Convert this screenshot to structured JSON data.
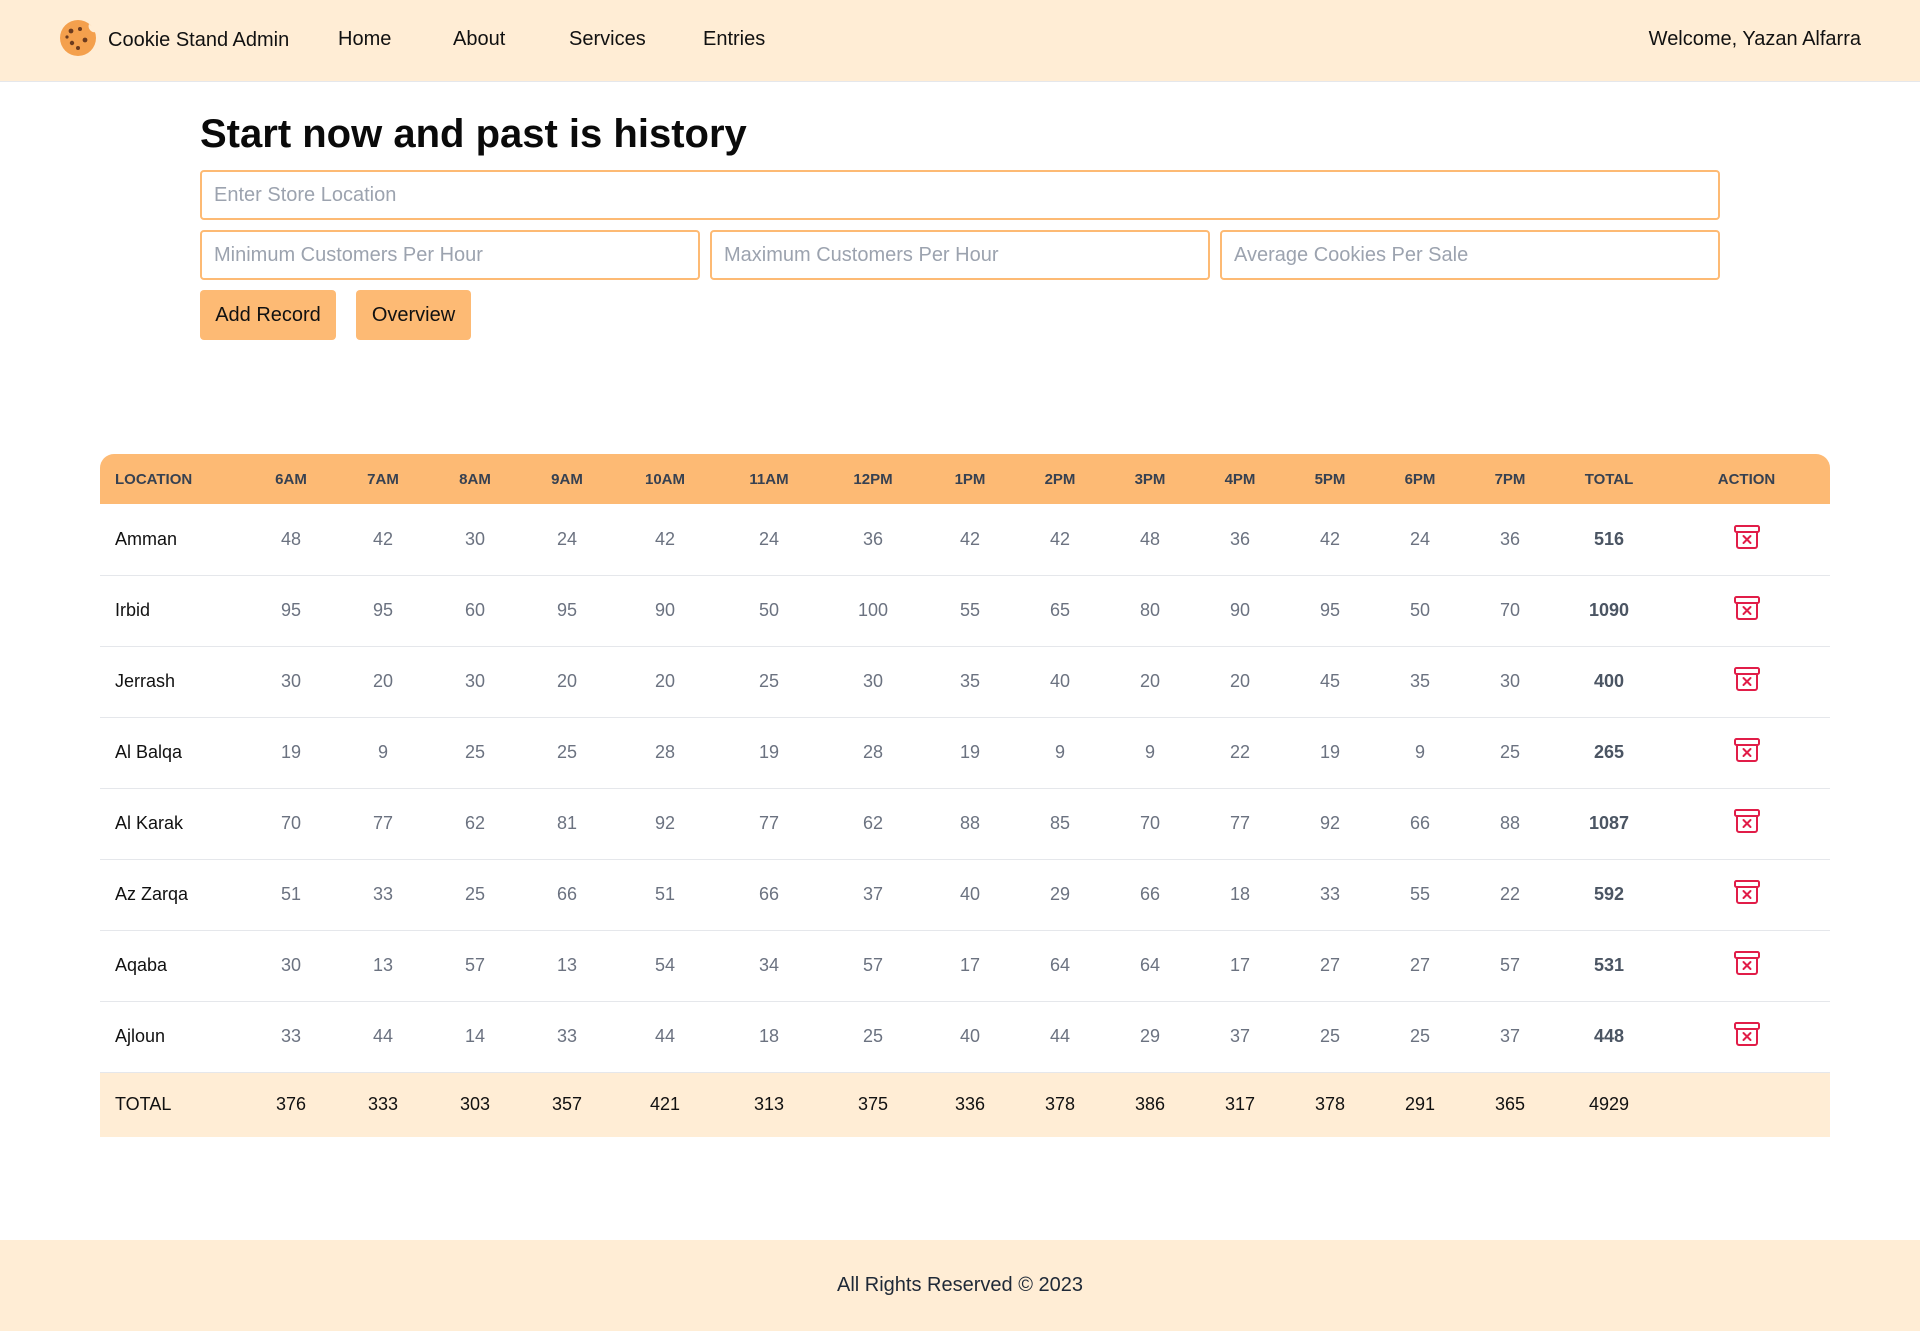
{
  "header": {
    "brand": "Cookie Stand Admin",
    "brand_icon": "cookie-icon",
    "nav": [
      {
        "label": "Home"
      },
      {
        "label": "About"
      },
      {
        "label": "Services"
      },
      {
        "label": "Entries"
      }
    ],
    "welcome": "Welcome, Yazan Alfarra"
  },
  "form": {
    "title": "Start now and past is history",
    "location_placeholder": "Enter Store Location",
    "min_placeholder": "Minimum Customers Per Hour",
    "max_placeholder": "Maximum Customers Per Hour",
    "avg_placeholder": "Average Cookies Per Sale",
    "add_label": "Add Record",
    "overview_label": "Overview"
  },
  "table": {
    "headers": [
      "LOCATION",
      "6AM",
      "7AM",
      "8AM",
      "9AM",
      "10AM",
      "11AM",
      "12PM",
      "1PM",
      "2PM",
      "3PM",
      "4PM",
      "5PM",
      "6PM",
      "7PM",
      "TOTAL",
      "ACTION"
    ],
    "action_icon": "trash-x-icon",
    "rows": [
      {
        "location": "Amman",
        "hours": [
          48,
          42,
          30,
          24,
          42,
          24,
          36,
          42,
          42,
          48,
          36,
          42,
          24,
          36
        ],
        "total": 516
      },
      {
        "location": "Irbid",
        "hours": [
          95,
          95,
          60,
          95,
          90,
          50,
          100,
          55,
          65,
          80,
          90,
          95,
          50,
          70
        ],
        "total": 1090
      },
      {
        "location": "Jerrash",
        "hours": [
          30,
          20,
          30,
          20,
          20,
          25,
          30,
          35,
          40,
          20,
          20,
          45,
          35,
          30
        ],
        "total": 400
      },
      {
        "location": "Al Balqa",
        "hours": [
          19,
          9,
          25,
          25,
          28,
          19,
          28,
          19,
          9,
          9,
          22,
          19,
          9,
          25
        ],
        "total": 265
      },
      {
        "location": "Al Karak",
        "hours": [
          70,
          77,
          62,
          81,
          92,
          77,
          62,
          88,
          85,
          70,
          77,
          92,
          66,
          88
        ],
        "total": 1087
      },
      {
        "location": "Az Zarqa",
        "hours": [
          51,
          33,
          25,
          66,
          51,
          66,
          37,
          40,
          29,
          66,
          18,
          33,
          55,
          22
        ],
        "total": 592
      },
      {
        "location": "Aqaba",
        "hours": [
          30,
          13,
          57,
          13,
          54,
          34,
          57,
          17,
          64,
          64,
          17,
          27,
          27,
          57
        ],
        "total": 531
      },
      {
        "location": "Ajloun",
        "hours": [
          33,
          44,
          14,
          33,
          44,
          18,
          25,
          40,
          44,
          29,
          37,
          25,
          25,
          37
        ],
        "total": 448
      }
    ],
    "totals": {
      "label": "TOTAL",
      "hours": [
        376,
        333,
        303,
        357,
        421,
        313,
        375,
        336,
        378,
        386,
        317,
        378,
        291,
        365
      ],
      "total": 4929
    }
  },
  "footer": {
    "text": "All Rights Reserved © 2023"
  },
  "colors": {
    "accent": "#fdba74",
    "header_bg": "#ffedd5",
    "delete": "#e11d48"
  }
}
